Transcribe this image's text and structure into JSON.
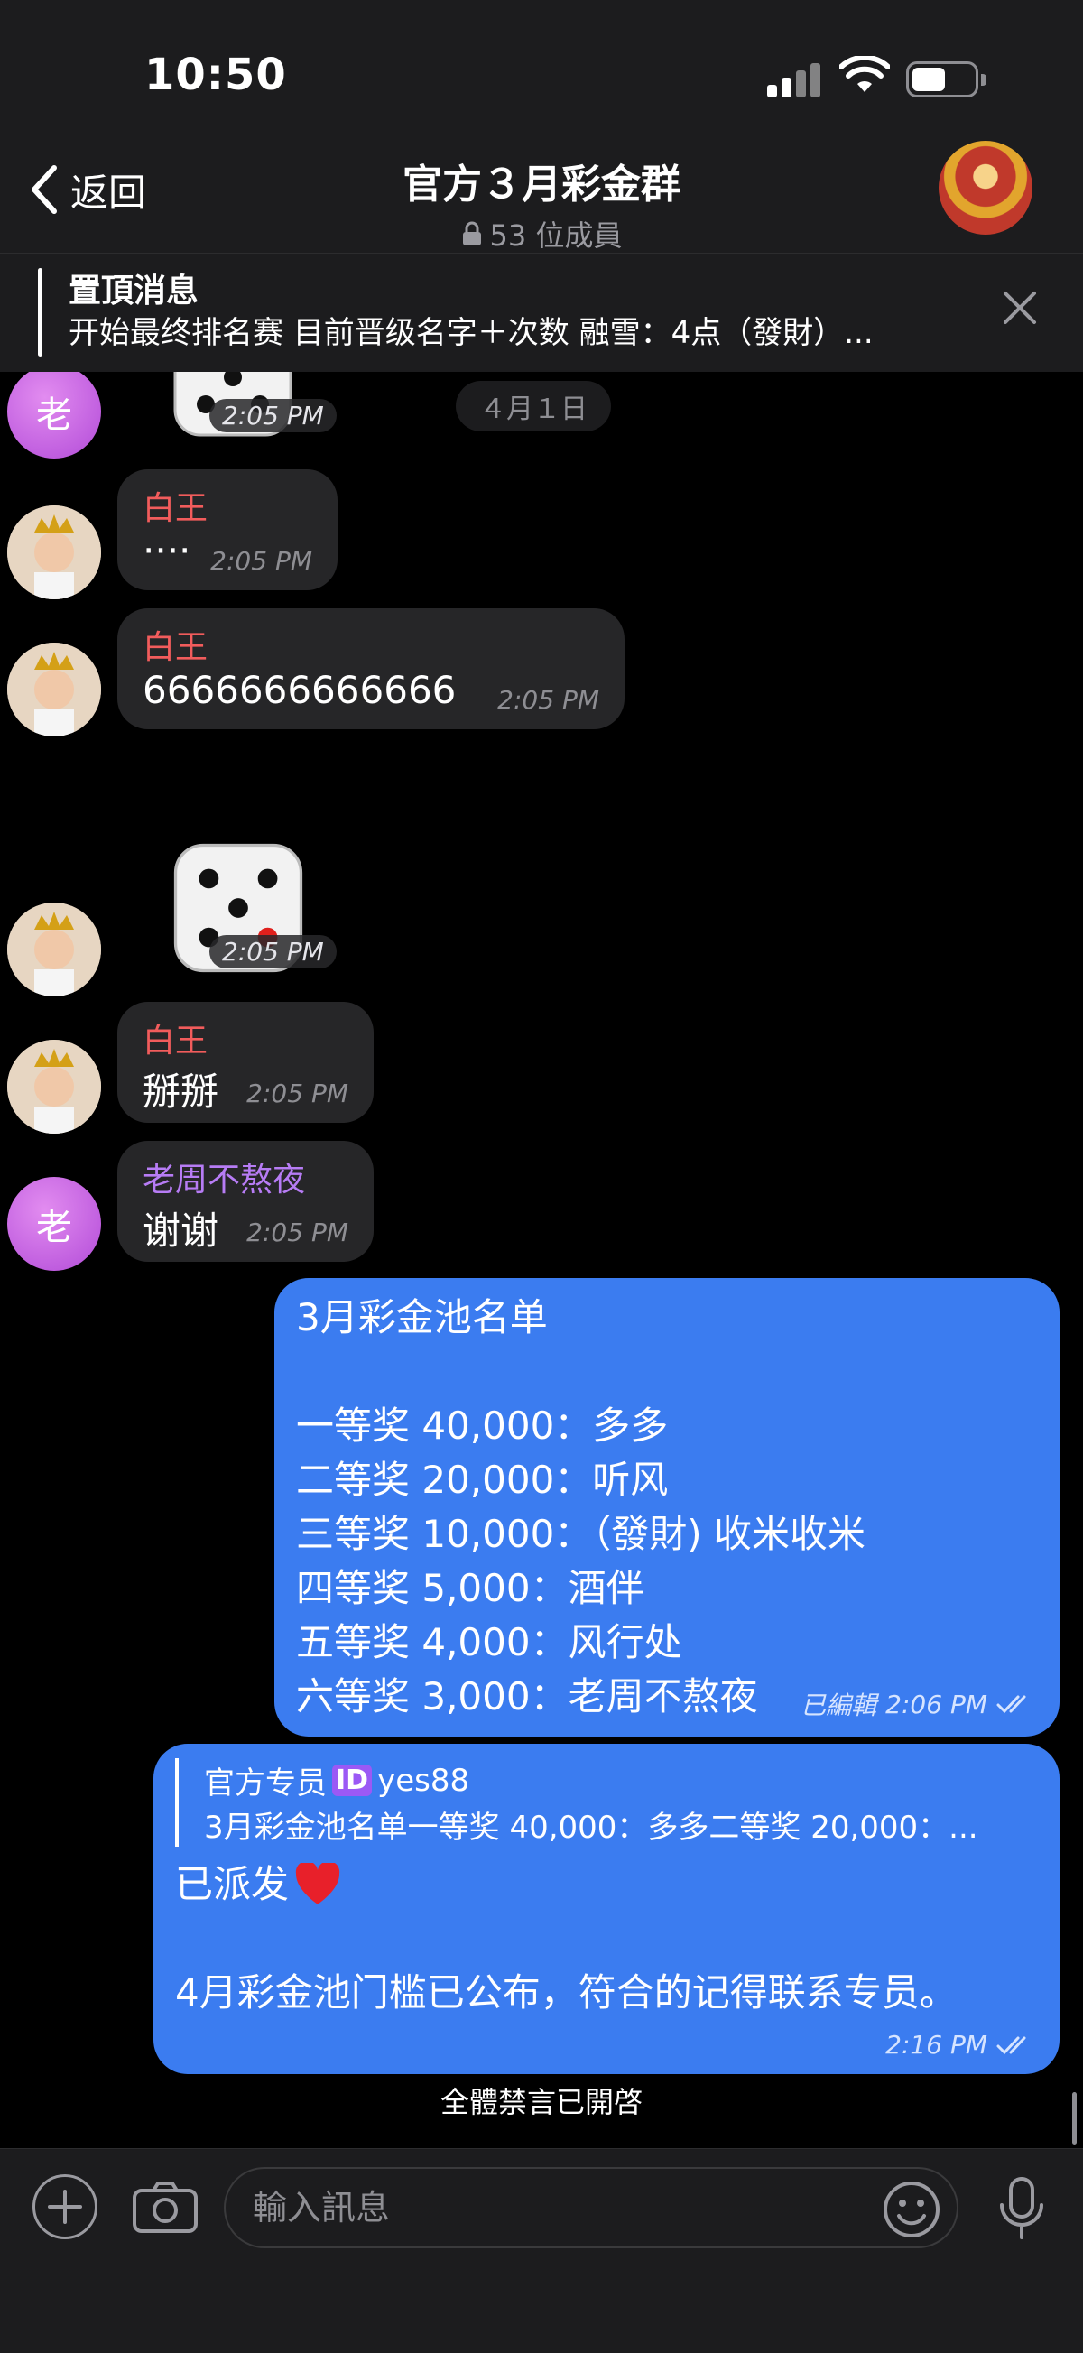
{
  "status_bar": {
    "time": "10:50"
  },
  "nav": {
    "back_label": "返回",
    "title": "官方３月彩金群",
    "members": "53 位成員"
  },
  "pinned": {
    "title": "置頂消息",
    "text": "开始最终排名赛 目前晋级名字＋次数  融雪：4点（發財）..."
  },
  "chat": {
    "date": "４月１日",
    "avatar_letter": "老",
    "messages": [
      {
        "type": "dice",
        "time": "2:05 PM"
      },
      {
        "sender": "白王",
        "text": "‧‧‧‧",
        "time": "2:05 PM"
      },
      {
        "sender": "白王",
        "text": "6666666666666",
        "time": "2:05 PM"
      },
      {
        "type": "dice",
        "time": "2:05 PM"
      },
      {
        "sender": "白王",
        "text": "掰掰",
        "time": "2:05 PM"
      },
      {
        "sender": "老周不熬夜",
        "text": "谢谢",
        "time": "2:05 PM"
      }
    ],
    "outgoing_1": {
      "title": "3月彩金池名单",
      "lines": [
        "一等奖 40,000：多多",
        "二等奖 20,000：听风",
        "三等奖 10,000：（發財) 收米收米",
        "四等奖 5,000：酒伴",
        "五等奖 4,000：风行处",
        "六等奖 3,000：老周不熬夜"
      ],
      "edited": "已編輯",
      "time": "2:06 PM"
    },
    "outgoing_2": {
      "reply_name": "官方专员",
      "reply_name_suffix": "yes88",
      "id_badge": "ID",
      "reply_text": "3月彩金池名单一等奖 40,000：多多二等奖 20,000：...",
      "line1": "已派发",
      "line2": "4月彩金池门槛已公布，符合的记得联系专员。",
      "time": "2:16 PM"
    },
    "notice": "全體禁言已開啓"
  },
  "input": {
    "placeholder": "輸入訊息"
  },
  "colors": {
    "accent": "#3b7cf0",
    "name_red": "#f25c5c",
    "name_purple": "#b77cf5"
  }
}
